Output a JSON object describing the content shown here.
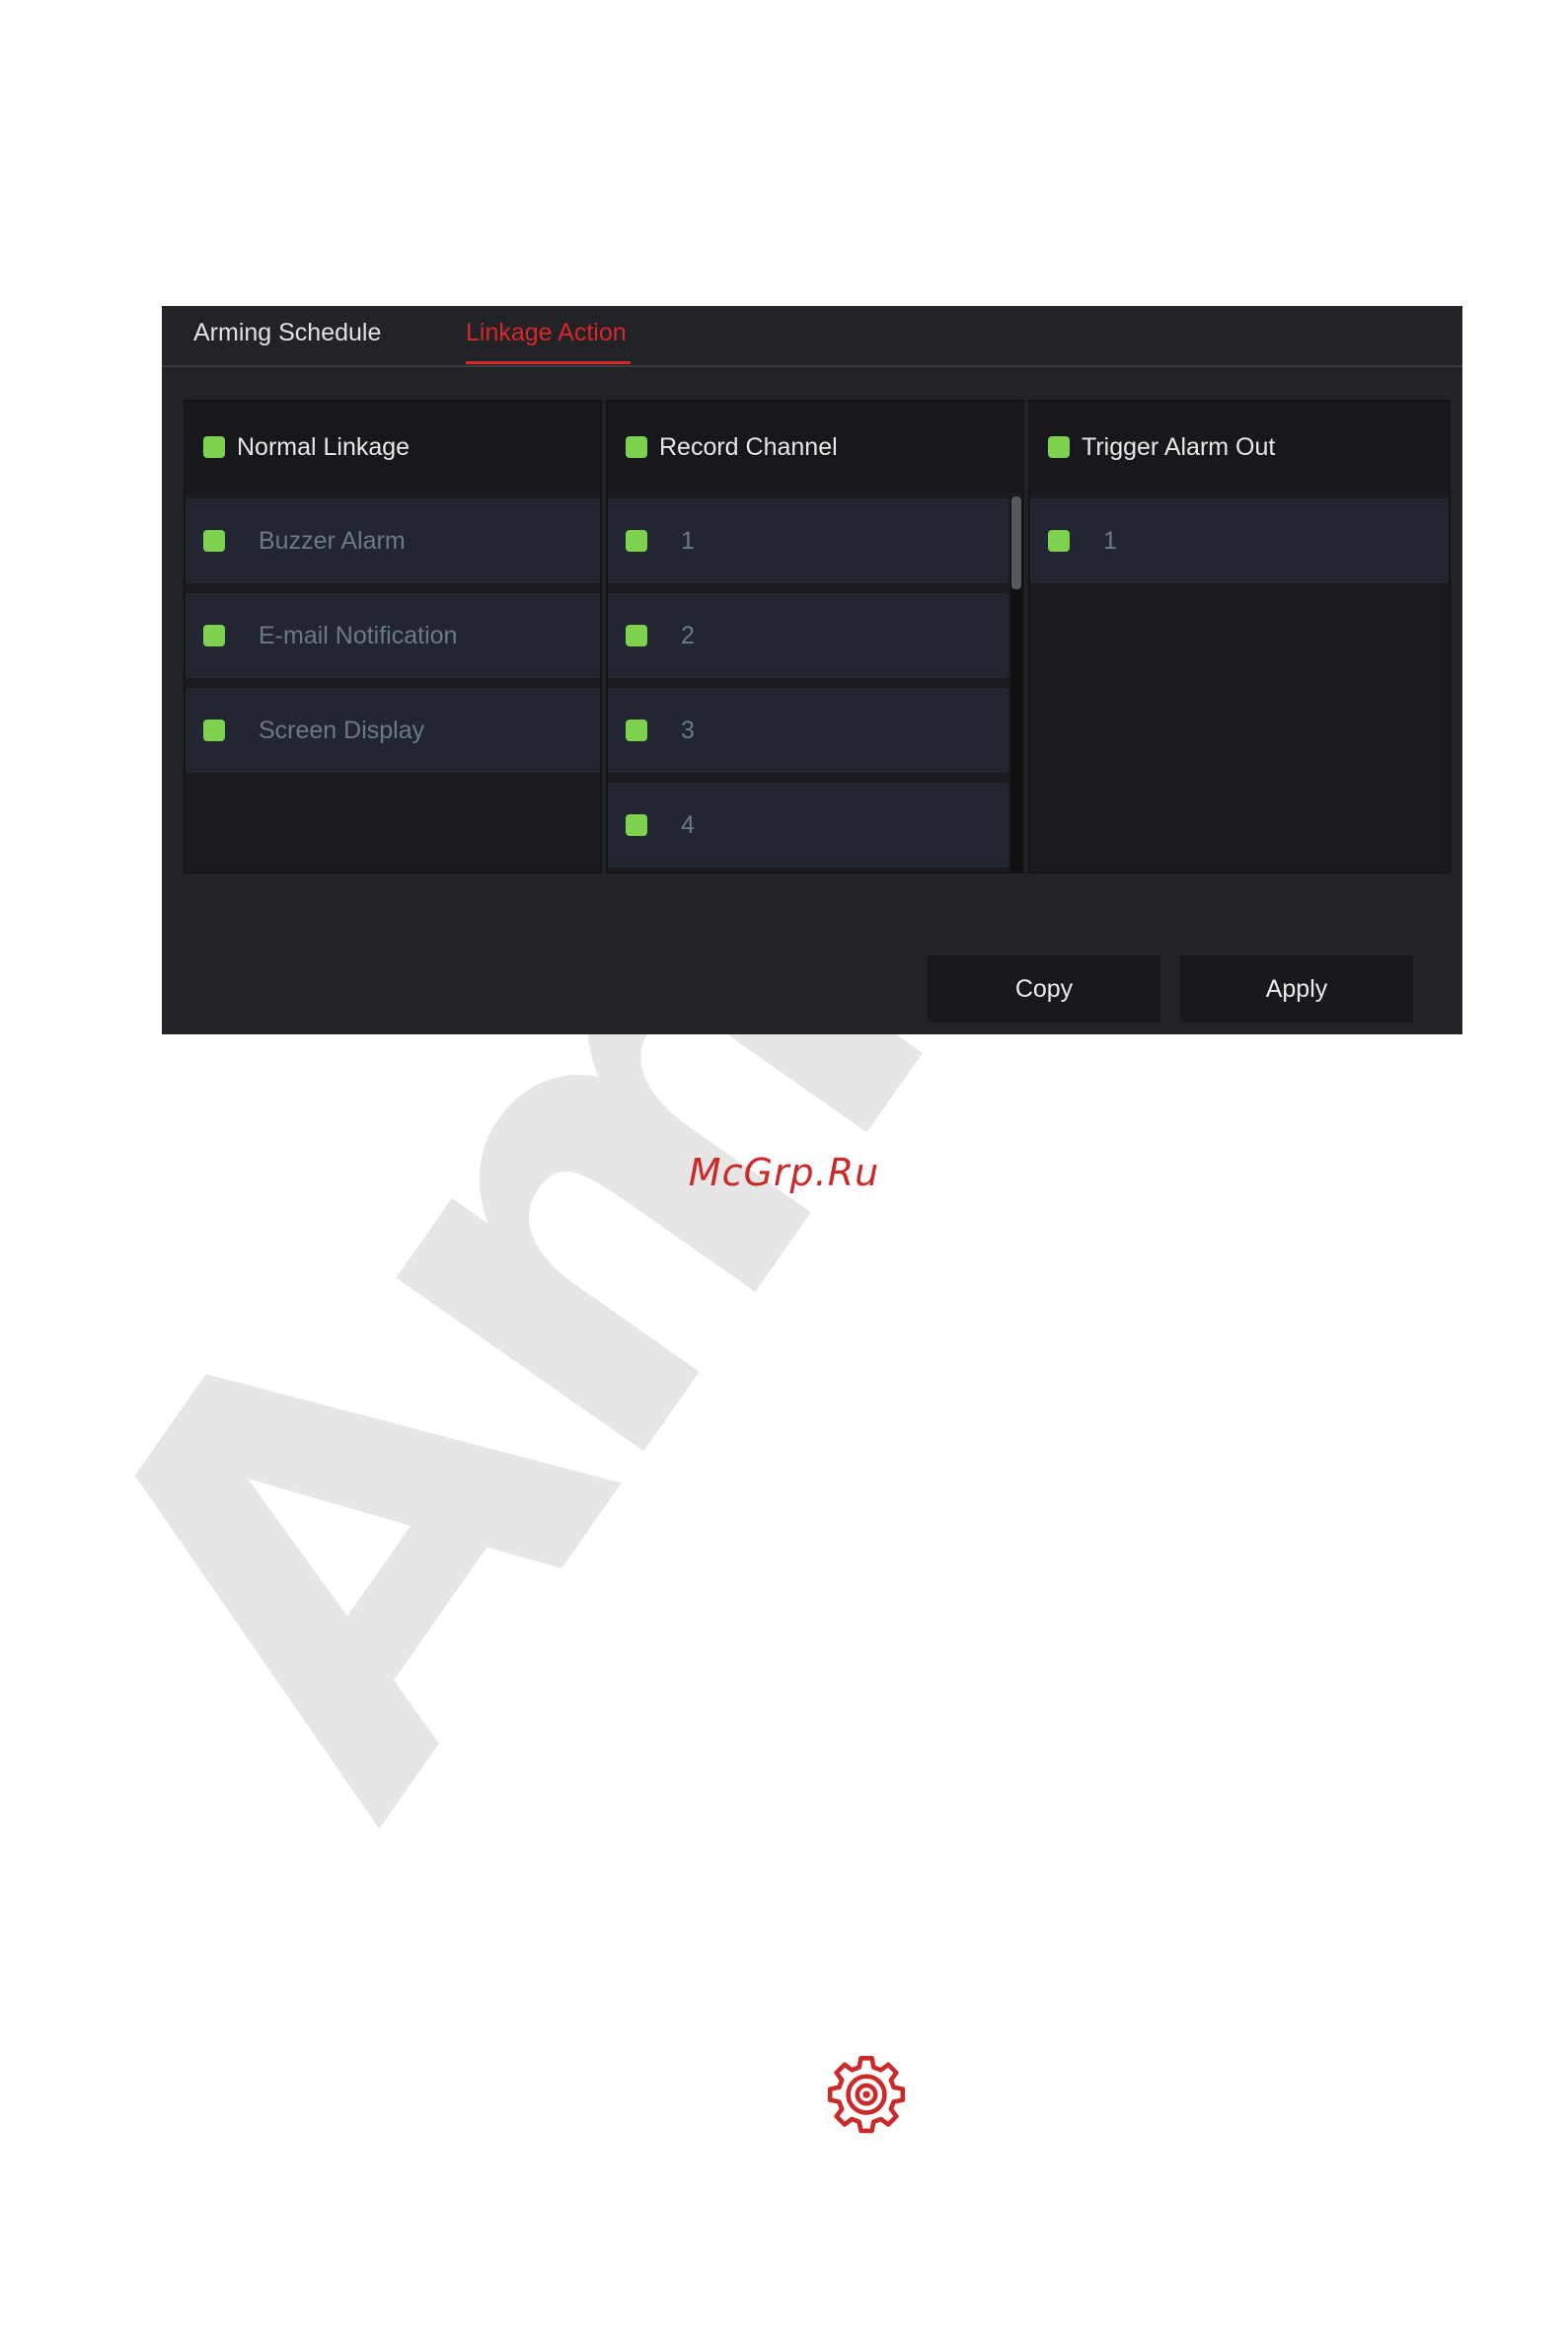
{
  "watermark": {
    "text": "Amat"
  },
  "tabs": [
    {
      "label": "Arming Schedule",
      "active": false
    },
    {
      "label": "Linkage Action",
      "active": true
    }
  ],
  "columns": [
    {
      "title": "Normal Linkage",
      "checked": true,
      "items": [
        {
          "label": "Buzzer Alarm",
          "checked": true
        },
        {
          "label": "E-mail Notification",
          "checked": true
        },
        {
          "label": "Screen Display",
          "checked": true
        }
      ]
    },
    {
      "title": "Record Channel",
      "checked": true,
      "items": [
        {
          "label": "1",
          "checked": true
        },
        {
          "label": "2",
          "checked": true
        },
        {
          "label": "3",
          "checked": true
        },
        {
          "label": "4",
          "checked": true
        }
      ]
    },
    {
      "title": "Trigger Alarm Out",
      "checked": true,
      "items": [
        {
          "label": "1",
          "checked": true
        }
      ]
    }
  ],
  "buttons": {
    "copy_label": "Copy",
    "apply_label": "Apply"
  },
  "site_mark": "McGrp.Ru",
  "icons": {
    "settings": "gear-icon"
  },
  "colors": {
    "accent": "#d8262a",
    "checkbox": "#7dd14f",
    "panel_bg": "#212327"
  }
}
